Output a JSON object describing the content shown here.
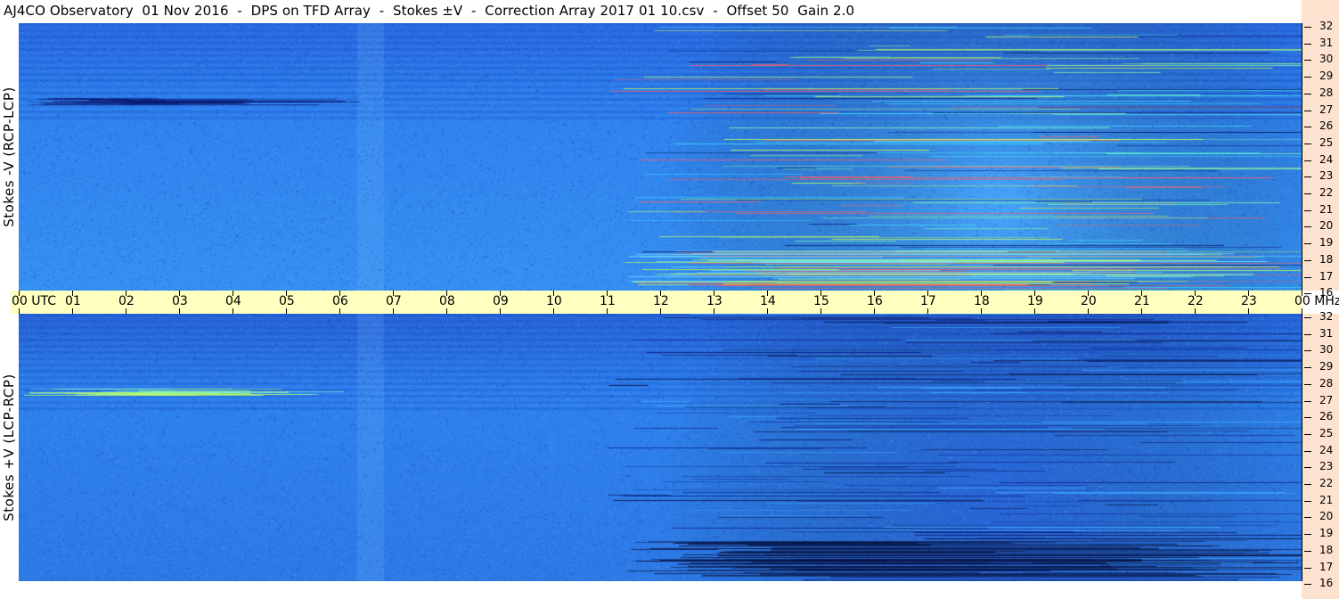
{
  "title": "AJ4CO Observatory  01 Nov 2016  -  DPS on TFD Array  -  Stokes ±V  -  Correction Array 2017 01 10.csv  -  Offset 50  Gain 2.0",
  "panels": {
    "top_label": "Stokes -V (RCP-LCP)",
    "bottom_label": "Stokes +V (LCP-RCP)"
  },
  "time_axis": {
    "labels": [
      "00 UTC",
      "01",
      "02",
      "03",
      "04",
      "05",
      "06",
      "07",
      "08",
      "09",
      "10",
      "11",
      "12",
      "13",
      "14",
      "15",
      "16",
      "17",
      "18",
      "19",
      "20",
      "21",
      "22",
      "23",
      "00 MHz"
    ]
  },
  "freq_axis": {
    "labels": [
      "32",
      "31",
      "30",
      "29",
      "28",
      "27",
      "26",
      "25",
      "24",
      "23",
      "22",
      "21",
      "20",
      "19",
      "18",
      "17",
      "16"
    ]
  },
  "colors": {
    "background_blue": "#2e80ee",
    "time_bar": "#ffffc0",
    "axis_strip": "#fde2d0"
  },
  "chart_data": {
    "type": "heatmap",
    "title": "AJ4CO Observatory  01 Nov 2016  -  DPS on TFD Array  -  Stokes ±V  -  Correction Array 2017 01 10.csv  -  Offset 50  Gain 2.0",
    "x_range_utc_hours": [
      0,
      24
    ],
    "y_range_mhz": [
      16,
      32
    ],
    "panels": [
      "Stokes -V (RCP-LCP)",
      "Stokes +V (LCP-RCP)"
    ],
    "xticks": [
      "00 UTC",
      "01",
      "02",
      "03",
      "04",
      "05",
      "06",
      "07",
      "08",
      "09",
      "10",
      "11",
      "12",
      "13",
      "14",
      "15",
      "16",
      "17",
      "18",
      "19",
      "20",
      "21",
      "22",
      "23",
      "00 MHz"
    ],
    "yticks": [
      32,
      31,
      30,
      29,
      28,
      27,
      26,
      25,
      24,
      23,
      22,
      21,
      20,
      19,
      18,
      17,
      16
    ]
  }
}
